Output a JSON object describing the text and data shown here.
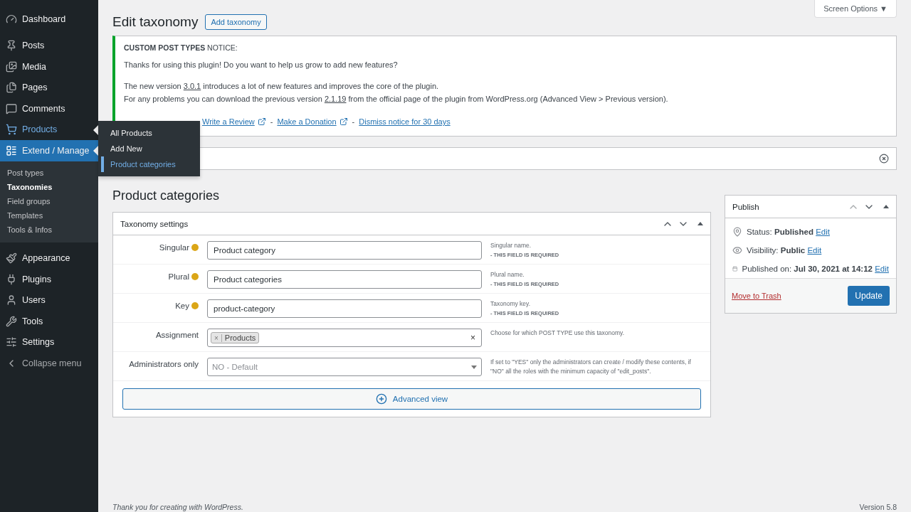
{
  "sidebar": {
    "items": [
      {
        "label": "Dashboard",
        "selected": false,
        "hovered": false
      },
      {
        "label": "Posts",
        "selected": false,
        "hovered": false
      },
      {
        "label": "Media",
        "selected": false,
        "hovered": false
      },
      {
        "label": "Pages",
        "selected": false,
        "hovered": false
      },
      {
        "label": "Comments",
        "selected": false,
        "hovered": false
      },
      {
        "label": "Products",
        "selected": false,
        "hovered": true
      },
      {
        "label": "Extend / Manage",
        "selected": true,
        "hovered": false,
        "children": [
          {
            "label": "Post types",
            "selected": false
          },
          {
            "label": "Taxonomies",
            "selected": true
          },
          {
            "label": "Field groups",
            "selected": false
          },
          {
            "label": "Templates",
            "selected": false
          },
          {
            "label": "Tools & Infos",
            "selected": false
          }
        ]
      },
      {
        "label": "Appearance",
        "selected": false,
        "hovered": false
      },
      {
        "label": "Plugins",
        "selected": false,
        "hovered": false
      },
      {
        "label": "Users",
        "selected": false,
        "hovered": false
      },
      {
        "label": "Tools",
        "selected": false,
        "hovered": false
      },
      {
        "label": "Settings",
        "selected": false,
        "hovered": false
      }
    ],
    "collapse": "Collapse menu",
    "flyout": [
      {
        "label": "All Products",
        "selected": false
      },
      {
        "label": "Add New",
        "selected": false
      },
      {
        "label": "Product categories",
        "selected": true
      }
    ]
  },
  "header": {
    "title": "Edit taxonomy",
    "button": "Add taxonomy",
    "screen_options": "Screen Options ▼"
  },
  "notice": {
    "title": "**CUSTOM POST TYPES** NOTICE:",
    "paragraphs": [
      [
        {
          "text": "Thanks for using this plugin! Do you want to help us grow to add new features?"
        }
      ],
      [
        {
          "text": "The new version "
        },
        {
          "link": "3.0.1"
        },
        {
          "text": " introduces a lot of new features and improves the core of the plugin."
        }
      ],
      [
        {
          "text": "For any problems you can download the previous version "
        },
        {
          "link": "2.1.19"
        },
        {
          "text": " from the official page of the plugin from WordPress.org (Advanced View > Previous version)."
        }
      ]
    ],
    "links": [
      {
        "label": "Write a Review",
        "external": true
      },
      {
        "label": "Make a Donation",
        "external": true
      },
      {
        "label": "Dismiss notice for 30 days",
        "external": false
      }
    ],
    "separator": "-"
  },
  "page_title": "Product categories",
  "settings": {
    "title": "Taxonomy settings",
    "fields": [
      {
        "kind": "text",
        "label": "Singular",
        "required": true,
        "value": "Product category",
        "help": "Singular name.",
        "help_required": "- THIS FIELD IS REQUIRED"
      },
      {
        "kind": "text",
        "label": "Plural",
        "required": true,
        "value": "Product categories",
        "help": "Plural name.",
        "help_required": "- THIS FIELD IS REQUIRED"
      },
      {
        "kind": "text",
        "label": "Key",
        "required": true,
        "value": "product-category",
        "help": "Taxonomy key.",
        "help_required": "- THIS FIELD IS REQUIRED"
      },
      {
        "kind": "tags",
        "label": "Assignment",
        "required": false,
        "tags": [
          "Products"
        ],
        "tag_remove": "×",
        "clear": "×",
        "help": "Choose for which POST TYPE use this taxonomy."
      },
      {
        "kind": "select",
        "label": "Administrators only",
        "required": false,
        "placeholder": "NO - Default",
        "help": "If set to \"YES\" only the administrators can create / modify these contents, if \"NO\" all the roles with the minimum capacity of \"edit_posts\"."
      }
    ],
    "advanced": "Advanced view"
  },
  "publish": {
    "title": "Publish",
    "rows": [
      {
        "text": "Status: **Published**",
        "link": "Edit"
      },
      {
        "text": "Visibility: **Public**",
        "link": "Edit"
      },
      {
        "text": "Published on: **Jul 30, 2021 at 14:12**",
        "link": "Edit"
      }
    ],
    "trash": "Move to Trash",
    "update": "Update"
  },
  "footer": {
    "thanks": "Thank you for creating with WordPress.",
    "version": "Version 5.8"
  }
}
